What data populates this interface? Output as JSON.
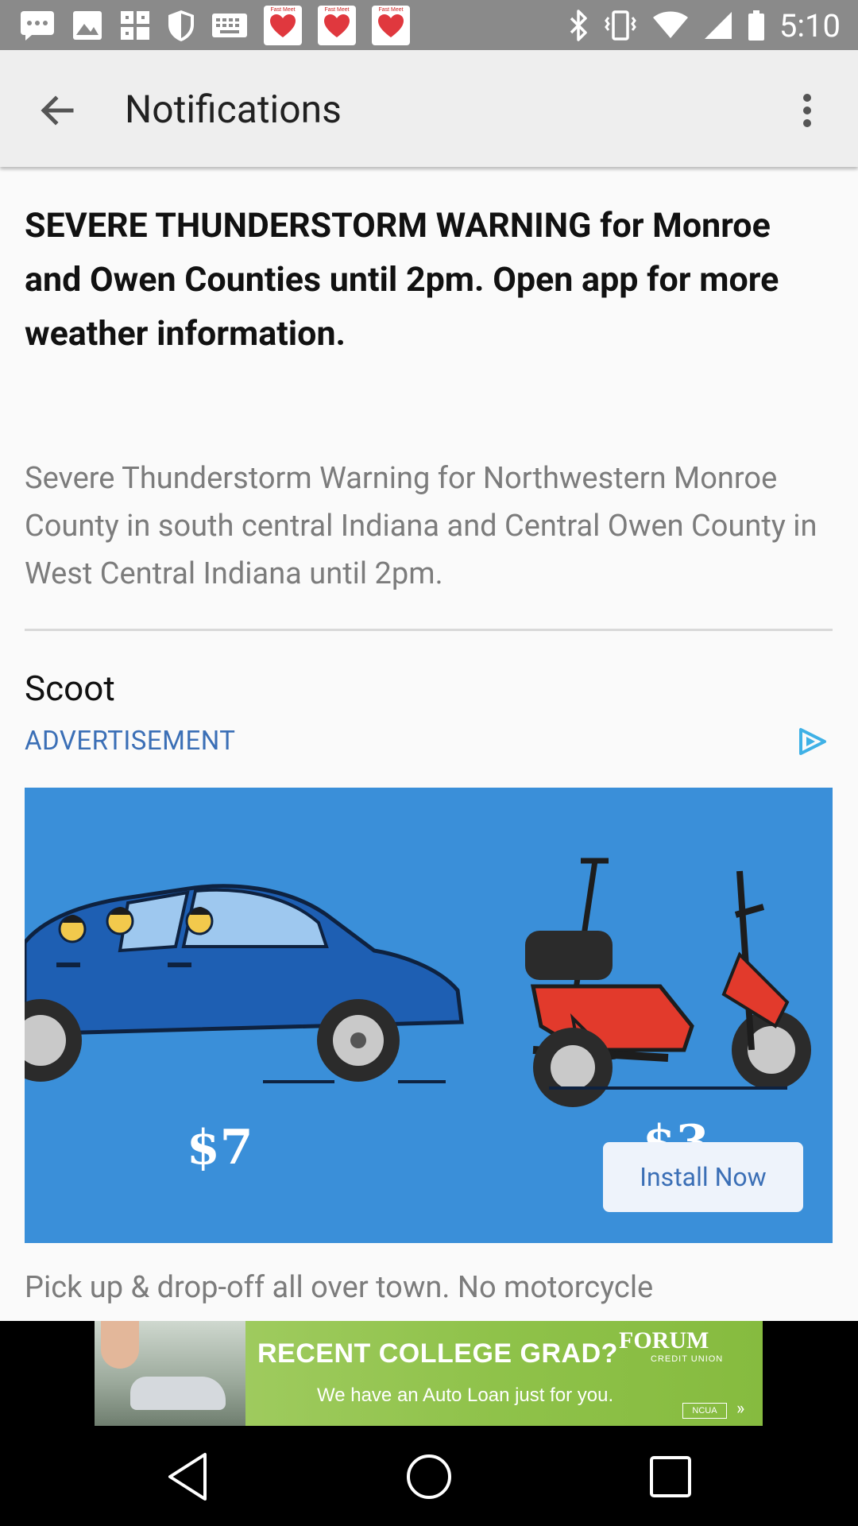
{
  "status_bar": {
    "time": "5:10",
    "left_icons": [
      "chat-icon",
      "image-icon",
      "grid-icon",
      "shield-icon",
      "keyboard-icon",
      "heart-app-icon",
      "heart-app-icon",
      "heart-app-icon"
    ],
    "heart_app_label": "Fast Meet"
  },
  "app_bar": {
    "title": "Notifications"
  },
  "notification": {
    "headline": "SEVERE THUNDERSTORM WARNING for Monroe and Owen Counties until 2pm. Open app for more weather information.",
    "body": "Severe Thunderstorm Warning for Northwestern Monroe County in south central Indiana and Central Owen County in West Central Indiana until 2pm."
  },
  "ad": {
    "sponsor": "Scoot",
    "label": "ADVERTISEMENT",
    "price_car": "$7",
    "price_scooter": "$3",
    "install_label": "Install Now",
    "description": "Pick up & drop-off all over town. No motorcycle",
    "colors": {
      "ad_background": "#3a8fd9",
      "link_blue": "#3b6fb6"
    }
  },
  "banner": {
    "headline": "RECENT COLLEGE GRAD?",
    "subline": "We have an Auto Loan just for you.",
    "brand": "FORUM",
    "brand_sub": "CREDIT UNION",
    "badge": "NCUA"
  }
}
